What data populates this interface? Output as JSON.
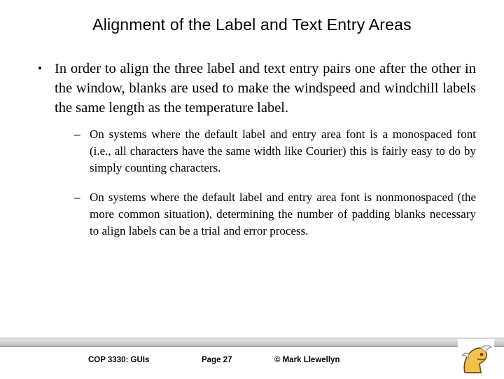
{
  "slide": {
    "title": "Alignment of the Label and Text Entry Areas",
    "bullets": [
      {
        "level": 1,
        "marker": "•",
        "text": "In order to align the three label and text entry pairs one after the other in the window, blanks are used to make the windspeed and windchill labels the same length as the temperature label."
      },
      {
        "level": 2,
        "marker": "–",
        "text": "On systems where the default label and entry area font is a monospaced font (i.e., all characters have the same width like Courier) this is fairly easy to do by simply counting characters."
      },
      {
        "level": 2,
        "marker": "–",
        "text": "On systems where the default label and entry area font is nonmonospaced (the more common situation), determining the number of padding blanks necessary to align labels can be a trial and error process."
      }
    ]
  },
  "footer": {
    "course": "COP 3330:  GUIs",
    "page": "Page 27",
    "copyright": "© Mark Llewellyn"
  },
  "logo": {
    "name": "ucf-knight-logo",
    "body_color": "#f2c14b",
    "outline_color": "#6b4a12",
    "plume_color": "#e6e6e6"
  }
}
